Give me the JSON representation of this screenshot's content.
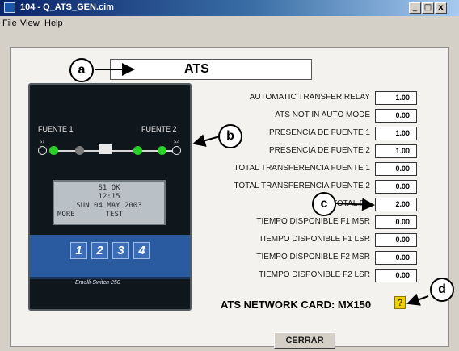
{
  "window": {
    "title": "104 - Q_ATS_GEN.cim",
    "buttons": {
      "minimize": "_",
      "maximize": "□",
      "close": "x"
    }
  },
  "menu": {
    "items": [
      "File",
      "View",
      "Help"
    ]
  },
  "panel": {
    "title": "ATS",
    "callouts": {
      "a": "a",
      "b": "b",
      "c": "c",
      "d": "d"
    },
    "device": {
      "source1": "FUENTE 1",
      "source2": "FUENTE 2",
      "s1": "S1",
      "s2": "S2",
      "lcd": [
        "S1 OK",
        "12:15",
        "SUN 04 MAY 2003",
        "MORE       TEST"
      ],
      "keys": [
        "1",
        "2",
        "3",
        "4"
      ],
      "brand": "Emelli-Switch 250"
    },
    "rows": [
      {
        "label": "AUTOMATIC TRANSFER RELAY",
        "value": "1.00"
      },
      {
        "label": "ATS NOT IN AUTO MODE",
        "value": "0.00"
      },
      {
        "label": "PRESENCIA DE FUENTE 1",
        "value": "1.00"
      },
      {
        "label": "PRESENCIA DE FUENTE 2",
        "value": "1.00"
      },
      {
        "label": "TOTAL TRANSFERENCIA FUENTE 1",
        "value": "0.00"
      },
      {
        "label": "TOTAL TRANSFERENCIA FUENTE 2",
        "value": "0.00"
      },
      {
        "label": "TOTAL F...",
        "value": "2.00"
      },
      {
        "label": "TIEMPO DISPONIBLE F1 MSR",
        "value": "0.00"
      },
      {
        "label": "TIEMPO DISPONIBLE F1 LSR",
        "value": "0.00"
      },
      {
        "label": "TIEMPO DISPONIBLE F2 MSR",
        "value": "0.00"
      },
      {
        "label": "TIEMPO DISPONIBLE F2 LSR",
        "value": "0.00"
      }
    ],
    "network_card": "ATS NETWORK CARD: MX150",
    "help_icon": "?",
    "close_button": "CERRAR"
  }
}
